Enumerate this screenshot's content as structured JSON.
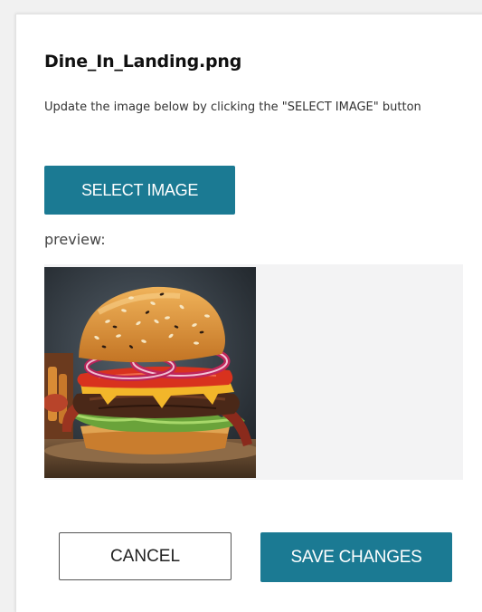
{
  "dialog": {
    "title": "Dine_In_Landing.png",
    "instructions": "Update the image below by clicking the \"SELECT IMAGE\" button",
    "select_button_label": "SELECT IMAGE",
    "preview_label": "preview:",
    "cancel_button_label": "CANCEL",
    "save_button_label": "SAVE CHANGES"
  },
  "preview": {
    "image_subject": "burger-photo-icon"
  },
  "colors": {
    "accent": "#1b7a93",
    "preview_background": "#f3f3f4"
  }
}
